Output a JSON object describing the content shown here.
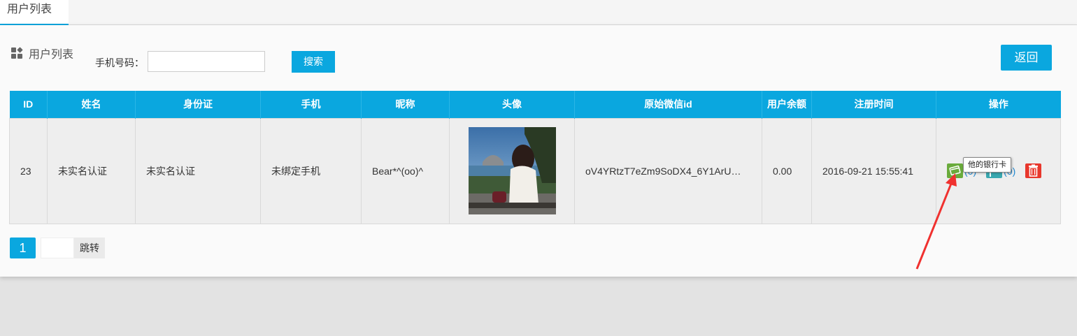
{
  "tab": {
    "label": "用户列表"
  },
  "section": {
    "title": "用户列表"
  },
  "search": {
    "label": "手机号码：",
    "value": "",
    "button": "搜索"
  },
  "back_button": "返回",
  "table": {
    "headers": [
      "ID",
      "姓名",
      "身份证",
      "手机",
      "昵称",
      "头像",
      "原始微信id",
      "用户余额",
      "注册时间",
      "操作"
    ],
    "rows": [
      {
        "id": "23",
        "name": "未实名认证",
        "id_card": "未实名认证",
        "phone": "未绑定手机",
        "nickname": "Bear*^(oo)^",
        "wechat_id": "oV4YRtzT7eZm9SoDX4_6Y1ArU…",
        "balance": "0.00",
        "reg_time": "2016-09-21 15:55:41",
        "bank_count": "(0)",
        "flag_count": "(0)"
      }
    ]
  },
  "tooltip": "他的银行卡",
  "pagination": {
    "current": "1",
    "jump": "跳转"
  },
  "colors": {
    "accent": "#0aa7df",
    "link": "#1e88d1",
    "delete": "#e8372c",
    "bank_icon": "#6aab3c",
    "flag_icon": "#3aa8b0",
    "arrow": "#f0312f"
  },
  "icons": [
    "grid-icon",
    "bank-card-icon",
    "flag-icon",
    "trash-icon"
  ]
}
